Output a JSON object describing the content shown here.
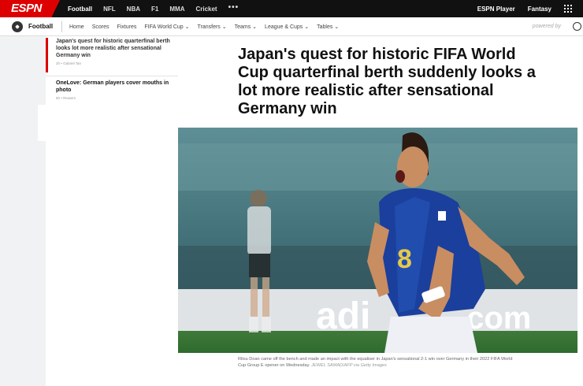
{
  "topbar": {
    "logo": "ESPN",
    "nav": [
      "Football",
      "NFL",
      "NBA",
      "F1",
      "MMA",
      "Cricket",
      "•••"
    ],
    "active": "Football",
    "right": [
      "ESPN Player",
      "Fantasy"
    ]
  },
  "subnav": {
    "title": "Football",
    "items": [
      "Home",
      "Scores",
      "Fixtures",
      "FIFA World Cup",
      "Transfers",
      "Teams",
      "League & Cups",
      "Tables"
    ],
    "powered_by": "powered by"
  },
  "sidebar": {
    "items": [
      {
        "title": "Japan's quest for historic quarterfinal berth looks lot more realistic after sensational Germany win",
        "meta": "2h • Gabriel Tan"
      },
      {
        "title": "OneLove: German players cover mouths in photo",
        "meta": "6h • Reuters"
      }
    ]
  },
  "article": {
    "headline": "Japan's quest for historic FIFA World Cup quarterfinal berth suddenly looks a lot more realistic after sensational Germany win",
    "photo_alt": "Ritsu Doan celebrating",
    "caption": "Ritsu Doan came off the bench and made an impact with the equaliser in Japan's sensational 2-1 win over Germany in their 2022 FIFA World Cup Group E opener on Wednesday.",
    "credit": "JEWEL SAMAD/AFP via Getty Images",
    "billboard_text": "adi",
    "billboard_text2": ".com",
    "jersey_number": "8"
  },
  "colors": {
    "brand": "#d00000",
    "topbar": "#111111",
    "jersey": "#1b3f9c"
  }
}
